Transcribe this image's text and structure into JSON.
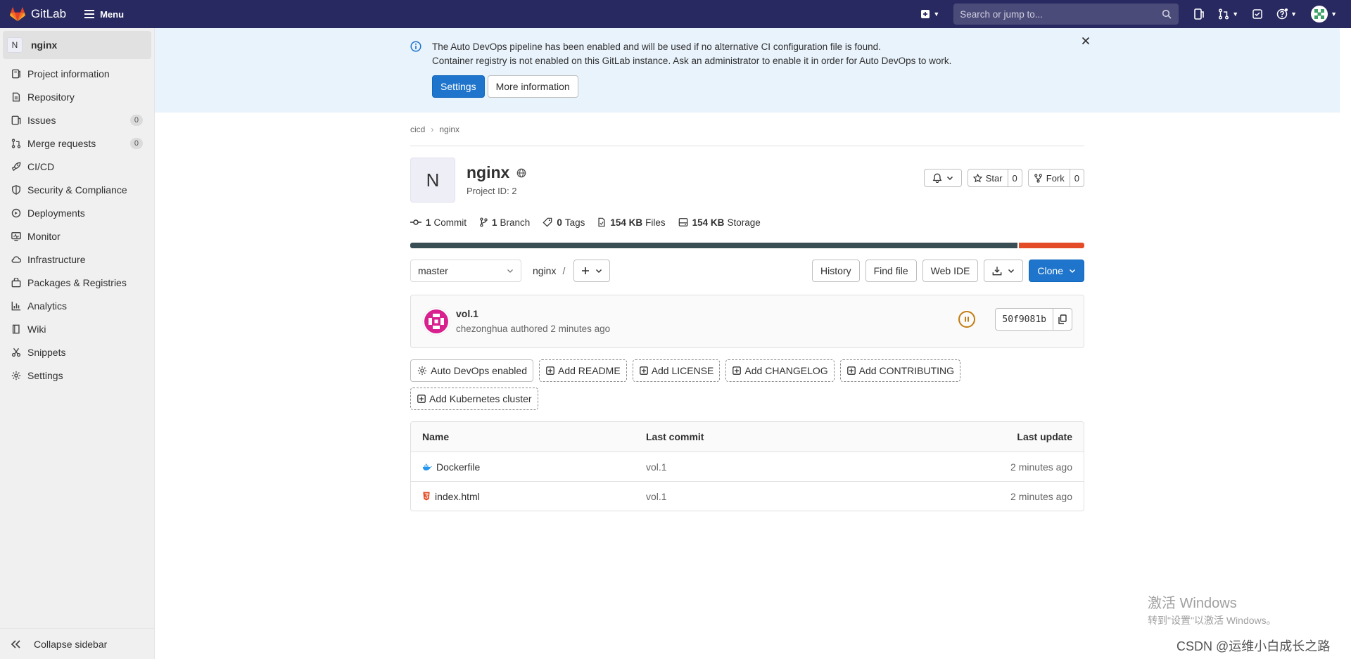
{
  "topbar": {
    "logo_text": "GitLab",
    "menu_label": "Menu",
    "search_placeholder": "Search or jump to..."
  },
  "sidebar": {
    "project_initial": "N",
    "project_name": "nginx",
    "items": [
      {
        "label": "Project information",
        "icon": "project-info-icon"
      },
      {
        "label": "Repository",
        "icon": "repository-icon"
      },
      {
        "label": "Issues",
        "icon": "issues-icon",
        "count": "0"
      },
      {
        "label": "Merge requests",
        "icon": "merge-request-icon",
        "count": "0"
      },
      {
        "label": "CI/CD",
        "icon": "rocket-icon"
      },
      {
        "label": "Security & Compliance",
        "icon": "shield-icon"
      },
      {
        "label": "Deployments",
        "icon": "deployments-icon"
      },
      {
        "label": "Monitor",
        "icon": "monitor-icon"
      },
      {
        "label": "Infrastructure",
        "icon": "cloud-icon"
      },
      {
        "label": "Packages & Registries",
        "icon": "package-icon"
      },
      {
        "label": "Analytics",
        "icon": "chart-icon"
      },
      {
        "label": "Wiki",
        "icon": "book-icon"
      },
      {
        "label": "Snippets",
        "icon": "scissors-icon"
      },
      {
        "label": "Settings",
        "icon": "gear-icon"
      }
    ],
    "collapse_label": "Collapse sidebar"
  },
  "alert": {
    "line1": "The Auto DevOps pipeline has been enabled and will be used if no alternative CI configuration file is found.",
    "line2": "Container registry is not enabled on this GitLab instance. Ask an administrator to enable it in order for Auto DevOps to work.",
    "settings_label": "Settings",
    "more_info_label": "More information"
  },
  "breadcrumb": [
    "cicd",
    "nginx"
  ],
  "project": {
    "initial": "N",
    "name": "nginx",
    "project_id": "Project ID: 2",
    "star_label": "Star",
    "star_count": "0",
    "fork_label": "Fork",
    "fork_count": "0"
  },
  "stats": {
    "commits_num": "1",
    "commits_label": "Commit",
    "branches_num": "1",
    "branches_label": "Branch",
    "tags_num": "0",
    "tags_label": "Tags",
    "files_num": "154 KB",
    "files_label": "Files",
    "storage_num": "154 KB",
    "storage_label": "Storage"
  },
  "language_bar": [
    {
      "share": 0.903,
      "color": "#384d54"
    },
    {
      "share": 0.097,
      "color": "#e34c26"
    }
  ],
  "tree": {
    "branch": "master",
    "path": "nginx",
    "path_sep": "/",
    "history_label": "History",
    "find_file_label": "Find file",
    "web_ide_label": "Web IDE",
    "clone_label": "Clone"
  },
  "commit": {
    "title": "vol.1",
    "author": "chezonghua",
    "authored_text": "authored 2 minutes ago",
    "sha": "50f9081b"
  },
  "quick_actions": [
    {
      "label": "Auto DevOps enabled",
      "icon": "gear-icon",
      "style": "solid"
    },
    {
      "label": "Add README",
      "icon": "plus-square-icon",
      "style": "dashed"
    },
    {
      "label": "Add LICENSE",
      "icon": "plus-square-icon",
      "style": "dashed"
    },
    {
      "label": "Add CHANGELOG",
      "icon": "plus-square-icon",
      "style": "dashed"
    },
    {
      "label": "Add CONTRIBUTING",
      "icon": "plus-square-icon",
      "style": "dashed"
    },
    {
      "label": "Add Kubernetes cluster",
      "icon": "plus-square-icon",
      "style": "dashed"
    }
  ],
  "files": {
    "headers": {
      "name": "Name",
      "last_commit": "Last commit",
      "last_update": "Last update"
    },
    "rows": [
      {
        "name": "Dockerfile",
        "icon": "docker-icon",
        "last_commit": "vol.1",
        "last_update": "2 minutes ago"
      },
      {
        "name": "index.html",
        "icon": "html5-icon",
        "last_commit": "vol.1",
        "last_update": "2 minutes ago"
      }
    ]
  },
  "watermark": {
    "line1": "激活 Windows",
    "line2": "转到\"设置\"以激活 Windows。",
    "csdn": "CSDN @运维小白成长之路"
  }
}
